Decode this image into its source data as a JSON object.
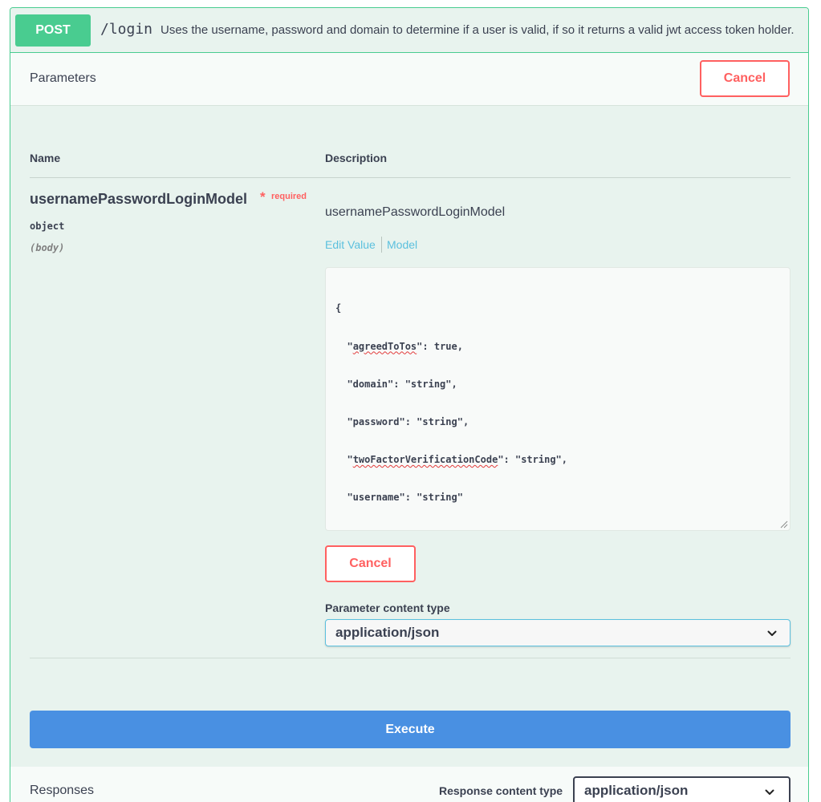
{
  "summary": {
    "method": "POST",
    "path": "/login",
    "description": "Uses the username, password and domain to determine if a user is valid, if so it returns a valid jwt access token holder."
  },
  "parameters": {
    "title": "Parameters",
    "cancel_label": "Cancel",
    "col_name": "Name",
    "col_description": "Description",
    "param": {
      "name": "usernamePasswordLoginModel",
      "required_star": "*",
      "required_label": "required",
      "type": "object",
      "in": "(body)",
      "description": "usernamePasswordLoginModel"
    },
    "tabs": {
      "edit_value": "Edit Value",
      "model": "Model"
    },
    "body_lines": [
      "{",
      "  \"agreedToTos\": true,",
      "  \"domain\": \"string\",",
      "  \"password\": \"string\",",
      "  \"twoFactorVerificationCode\": \"string\",",
      "  \"username\": \"string\"",
      "}"
    ],
    "cancel_mid_label": "Cancel",
    "content_type_label": "Parameter content type",
    "content_type_value": "application/json"
  },
  "execute_label": "Execute",
  "responses": {
    "title": "Responses",
    "content_type_label": "Response content type",
    "content_type_value": "application/json"
  },
  "colors": {
    "post_green": "#49cc90",
    "cancel_red": "#ff6060",
    "execute_blue": "#4990e2",
    "link_blue": "#5bc0de"
  }
}
